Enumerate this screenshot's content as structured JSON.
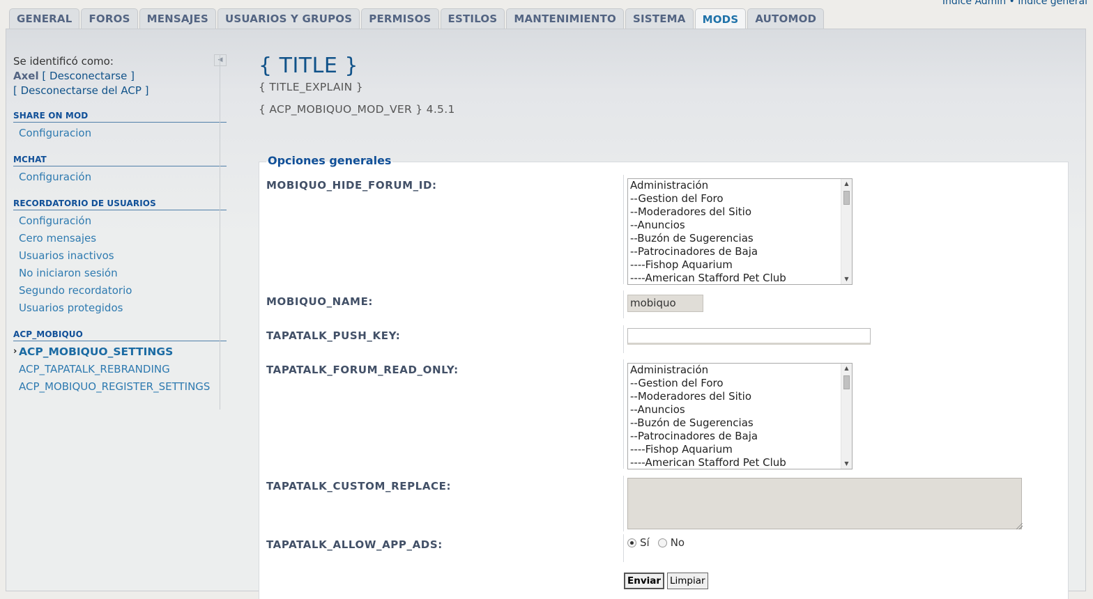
{
  "top_links": {
    "admin_index": "Índice Admin",
    "separator": "•",
    "board_index": "Índice general"
  },
  "tabs": [
    {
      "label": "GENERAL"
    },
    {
      "label": "FOROS"
    },
    {
      "label": "MENSAJES"
    },
    {
      "label": "USUARIOS Y GRUPOS"
    },
    {
      "label": "PERMISOS"
    },
    {
      "label": "ESTILOS"
    },
    {
      "label": "MANTENIMIENTO"
    },
    {
      "label": "SISTEMA"
    },
    {
      "label": "MODS",
      "active": true
    },
    {
      "label": "AUTOMOD"
    }
  ],
  "sidebar": {
    "logged_in_as": "Se identificó como:",
    "username": "Axel",
    "logout": "Desconectarse",
    "logout_acp": "Desconectarse del ACP",
    "collapse_icon": "collapse-arrow-icon",
    "sections": [
      {
        "title": "SHARE ON MOD",
        "items": [
          "Configuracion"
        ]
      },
      {
        "title": "MCHAT",
        "items": [
          "Configuración"
        ]
      },
      {
        "title": "RECORDATORIO DE USUARIOS",
        "items": [
          "Configuración",
          "Cero mensajes",
          "Usuarios inactivos",
          "No iniciaron sesión",
          "Segundo recordatorio",
          "Usuarios protegidos"
        ]
      },
      {
        "title": "ACP_MOBIQUO",
        "items": [
          "ACP_MOBIQUO_SETTINGS",
          "ACP_TAPATALK_REBRANDING",
          "ACP_MOBIQUO_REGISTER_SETTINGS"
        ]
      }
    ]
  },
  "main": {
    "title": "{ TITLE }",
    "explain": "{ TITLE_EXPLAIN }",
    "version_label": "{ ACP_MOBIQUO_MOD_VER }",
    "version": "4.5.1",
    "legend": "Opciones generales",
    "fields": {
      "hide_forum_id": {
        "label": "MOBIQUO_HIDE_FORUM_ID:"
      },
      "name": {
        "label": "MOBIQUO_NAME:",
        "value": "mobiquo"
      },
      "push_key": {
        "label": "TAPATALK_PUSH_KEY:",
        "value": ""
      },
      "read_only": {
        "label": "TAPATALK_FORUM_READ_ONLY:"
      },
      "custom_replace": {
        "label": "TAPATALK_CUSTOM_REPLACE:",
        "value": ""
      },
      "allow_ads": {
        "label": "TAPATALK_ALLOW_APP_ADS:",
        "yes": "Sí",
        "no": "No",
        "selected": "Sí"
      }
    },
    "forum_options": [
      "Administración",
      "--Gestion del Foro",
      "--Moderadores del Sitio",
      "--Anuncios",
      "--Buzón de Sugerencias",
      "--Patrocinadores de Baja",
      "----Fishop Aquarium",
      "----American Stafford Pet Club"
    ],
    "submit": "Enviar",
    "reset": "Limpiar"
  }
}
